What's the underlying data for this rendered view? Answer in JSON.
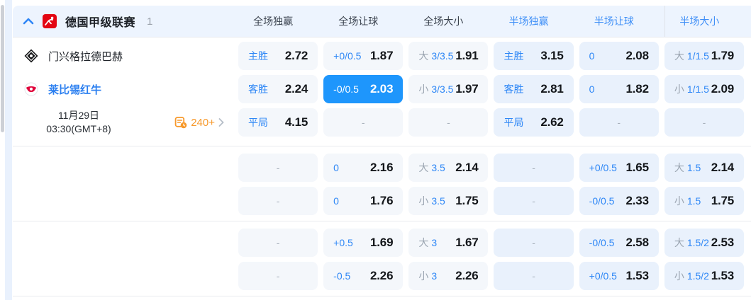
{
  "colors": {
    "accent_blue": "#2e87f6",
    "selected_cell_blue": "#1e96fc",
    "half_header_blue": "#3f8ff7",
    "orange": "#f7992b",
    "cell_bg_full": "#f4f7fb",
    "cell_bg_half": "#e9f1fc",
    "header_bg": "#edf4fe",
    "league_logo_red": "#e30613"
  },
  "header": {
    "league_name": "德国甲级联赛",
    "match_count": "1",
    "columns": [
      {
        "label": "全场独赢",
        "half": false
      },
      {
        "label": "全场让球",
        "half": false
      },
      {
        "label": "全场大小",
        "half": false
      },
      {
        "label": "半场独赢",
        "half": true
      },
      {
        "label": "半场让球",
        "half": true
      },
      {
        "label": "半场大小",
        "half": true
      }
    ]
  },
  "match": {
    "home_team": "门兴格拉德巴赫",
    "away_team": "莱比锡红牛",
    "date": "11月29日",
    "time": "03:30(GMT+8)",
    "more_markets": "240+"
  },
  "icons": {
    "collapse": "chevron-up-icon",
    "league": "bundesliga-logo",
    "home_badge": "moenchengladbach-badge",
    "away_badge": "leipzig-badge",
    "markets": "markets-clock-icon",
    "more": "chevron-right-icon"
  },
  "odds": {
    "empty_placeholder": "-",
    "rows": [
      [
        {
          "label": "主胜",
          "value": "2.72"
        },
        {
          "label": "+0/0.5",
          "value": "1.87"
        },
        {
          "prefix": "大",
          "label": "3/3.5",
          "value": "1.91"
        },
        {
          "label": "主胜",
          "value": "3.15"
        },
        {
          "label": "0",
          "value": "2.08"
        },
        {
          "prefix": "大",
          "label": "1/1.5",
          "value": "1.79"
        }
      ],
      [
        {
          "label": "客胜",
          "value": "2.24"
        },
        {
          "label": "-0/0.5",
          "value": "2.03",
          "selected": true
        },
        {
          "prefix": "小",
          "label": "3/3.5",
          "value": "1.97"
        },
        {
          "label": "客胜",
          "value": "2.81"
        },
        {
          "label": "0",
          "value": "1.82"
        },
        {
          "prefix": "小",
          "label": "1/1.5",
          "value": "2.09"
        }
      ],
      [
        {
          "label": "平局",
          "value": "4.15"
        },
        {
          "empty": true
        },
        {
          "empty": true
        },
        {
          "label": "平局",
          "value": "2.62"
        },
        {
          "empty": true
        },
        {
          "empty": true
        }
      ],
      [
        {
          "empty": true
        },
        {
          "label": "0",
          "value": "2.16"
        },
        {
          "prefix": "大",
          "label": "3.5",
          "value": "2.14"
        },
        {
          "empty": true
        },
        {
          "label": "+0/0.5",
          "value": "1.65"
        },
        {
          "prefix": "大",
          "label": "1.5",
          "value": "2.14"
        }
      ],
      [
        {
          "empty": true
        },
        {
          "label": "0",
          "value": "1.76"
        },
        {
          "prefix": "小",
          "label": "3.5",
          "value": "1.75"
        },
        {
          "empty": true
        },
        {
          "label": "-0/0.5",
          "value": "2.33"
        },
        {
          "prefix": "小",
          "label": "1.5",
          "value": "1.75"
        }
      ],
      [
        {
          "empty": true
        },
        {
          "label": "+0.5",
          "value": "1.69"
        },
        {
          "prefix": "大",
          "label": "3",
          "value": "1.67"
        },
        {
          "empty": true
        },
        {
          "label": "-0/0.5",
          "value": "2.58"
        },
        {
          "prefix": "大",
          "label": "1.5/2",
          "value": "2.53"
        }
      ],
      [
        {
          "empty": true
        },
        {
          "label": "-0.5",
          "value": "2.26"
        },
        {
          "prefix": "小",
          "label": "3",
          "value": "2.26"
        },
        {
          "empty": true
        },
        {
          "label": "+0/0.5",
          "value": "1.53"
        },
        {
          "prefix": "小",
          "label": "1.5/2",
          "value": "1.53"
        }
      ]
    ]
  }
}
